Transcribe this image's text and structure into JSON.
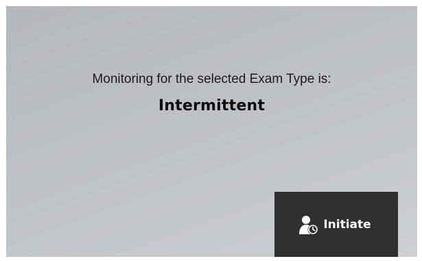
{
  "dialog": {
    "message": "Monitoring for the selected Exam Type is:",
    "monitoring_mode": "Intermittent"
  },
  "actions": {
    "initiate": {
      "label": "Initiate",
      "icon": "user-clock-icon"
    }
  },
  "colors": {
    "button_background": "#2f2f2f",
    "button_text": "#ffffff",
    "panel_background": "#bdc0c4",
    "text": "#1b1b1b"
  }
}
